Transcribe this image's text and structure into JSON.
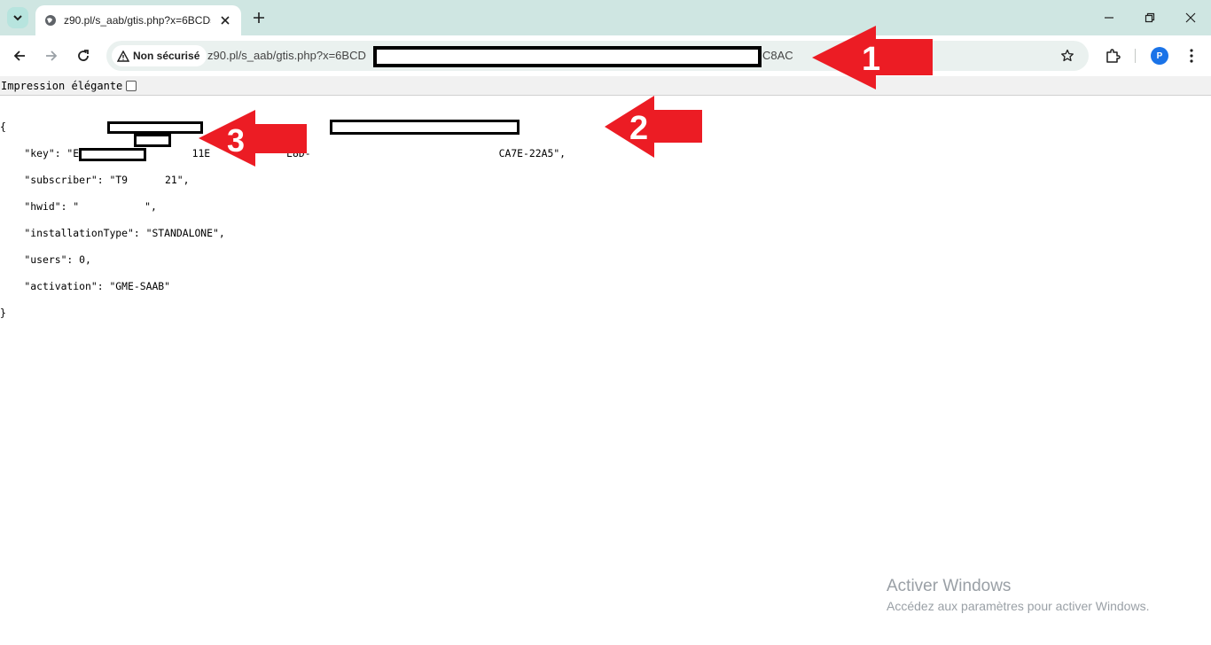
{
  "tab": {
    "title": "z90.pl/s_aab/gtis.php?x=6BCD5"
  },
  "omnibox": {
    "security_label": "Non sécurisé",
    "url_start": "z90.pl/s_aab/gtis.php?x=6BCD",
    "url_end": "C8AC"
  },
  "profile": {
    "initial": "P"
  },
  "pretty_print": {
    "label": "Impression élégante",
    "checked": false
  },
  "json_lines": {
    "open": "{",
    "key_a": "    \"key\": \"E194-",
    "key_b": "11E",
    "key_c": "E8D-",
    "key_d": "CA7E-22A5\",",
    "subscriber_a": "    \"subscriber\": \"T9",
    "subscriber_b": "21\",",
    "hwid_a": "    \"hwid\": \"",
    "hwid_b": "\",",
    "install": "    \"installationType\": \"STANDALONE\",",
    "users": "    \"users\": 0,",
    "activation": "    \"activation\": \"GME-SAAB\"",
    "close": "}"
  },
  "annotations": [
    {
      "number": "1"
    },
    {
      "number": "2"
    },
    {
      "number": "3"
    }
  ],
  "annotation_color": "#ec1c24",
  "watermark": {
    "title": "Activer Windows",
    "subtitle": "Accédez aux paramètres pour activer Windows."
  }
}
